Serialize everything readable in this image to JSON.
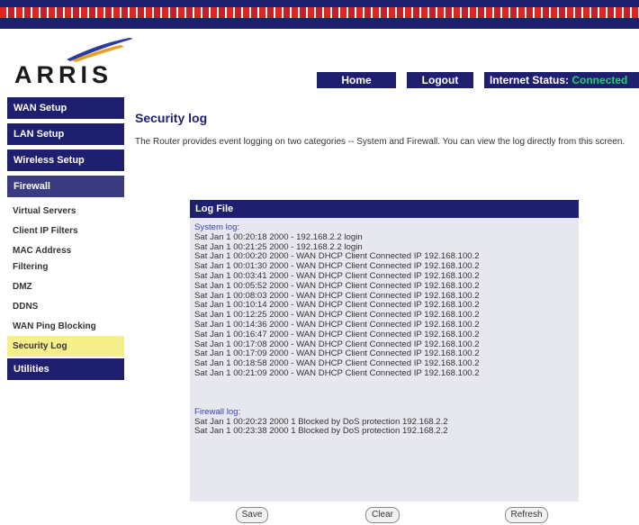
{
  "brand": {
    "logo_text": "ARRIS"
  },
  "topnav": {
    "home": "Home",
    "logout": "Logout",
    "status_label": "Internet Status:",
    "status_value": "Connected"
  },
  "sidebar": {
    "wan_setup": "WAN Setup",
    "lan_setup": "LAN Setup",
    "wireless_setup": "Wireless Setup",
    "firewall": "Firewall",
    "sub_items": {
      "virtual_servers": "Virtual Servers",
      "client_ip_filters": "Client IP Filters",
      "mac_address": "MAC Address",
      "filtering": "Filtering",
      "dmz": "DMZ",
      "ddns": "DDNS",
      "wan_ping_blocking": "WAN Ping Blocking",
      "security_log": "Security Log"
    },
    "utilities": "Utilities"
  },
  "page": {
    "title": "Security log",
    "description": "The Router provides event logging on two categories -- System and Firewall. You can view the log directly from this screen."
  },
  "log": {
    "header": "Log File",
    "system_label": "System log:",
    "system_lines": [
      "Sat Jan 1 00:20:18 2000 - 192.168.2.2 login",
      "Sat Jan 1 00:21:25 2000 - 192.168.2.2 login",
      "Sat Jan 1 00:00:20 2000 - WAN DHCP Client Connected IP 192.168.100.2",
      "Sat Jan 1 00:01:30 2000 - WAN DHCP Client Connected IP 192.168.100.2",
      "Sat Jan 1 00:03:41 2000 - WAN DHCP Client Connected IP 192.168.100.2",
      "Sat Jan 1 00:05:52 2000 - WAN DHCP Client Connected IP 192.168.100.2",
      "Sat Jan 1 00:08:03 2000 - WAN DHCP Client Connected IP 192.168.100.2",
      "Sat Jan 1 00:10:14 2000 - WAN DHCP Client Connected IP 192.168.100.2",
      "Sat Jan 1 00:12:25 2000 - WAN DHCP Client Connected IP 192.168.100.2",
      "Sat Jan 1 00:14:36 2000 - WAN DHCP Client Connected IP 192.168.100.2",
      "Sat Jan 1 00:16:47 2000 - WAN DHCP Client Connected IP 192.168.100.2",
      "Sat Jan 1 00:17:08 2000 - WAN DHCP Client Connected IP 192.168.100.2",
      "Sat Jan 1 00:17:09 2000 - WAN DHCP Client Connected IP 192.168.100.2",
      "Sat Jan 1 00:18:58 2000 - WAN DHCP Client Connected IP 192.168.100.2",
      "Sat Jan 1 00:21:09 2000 - WAN DHCP Client Connected IP 192.168.100.2"
    ],
    "firewall_label": "Firewall log:",
    "firewall_lines": [
      "Sat Jan 1 00:20:23 2000 1 Blocked by DoS protection 192.168.2.2",
      "Sat Jan 1 00:23:38 2000 1 Blocked by DoS protection 192.168.2.2"
    ]
  },
  "buttons": {
    "save": "Save",
    "clear": "Clear",
    "refresh": "Refresh"
  },
  "colors": {
    "navy": "#1e1f6e",
    "highlight": "#f5f08a",
    "status_green": "#1fd36b",
    "log_bg": "#e7e7f0"
  }
}
